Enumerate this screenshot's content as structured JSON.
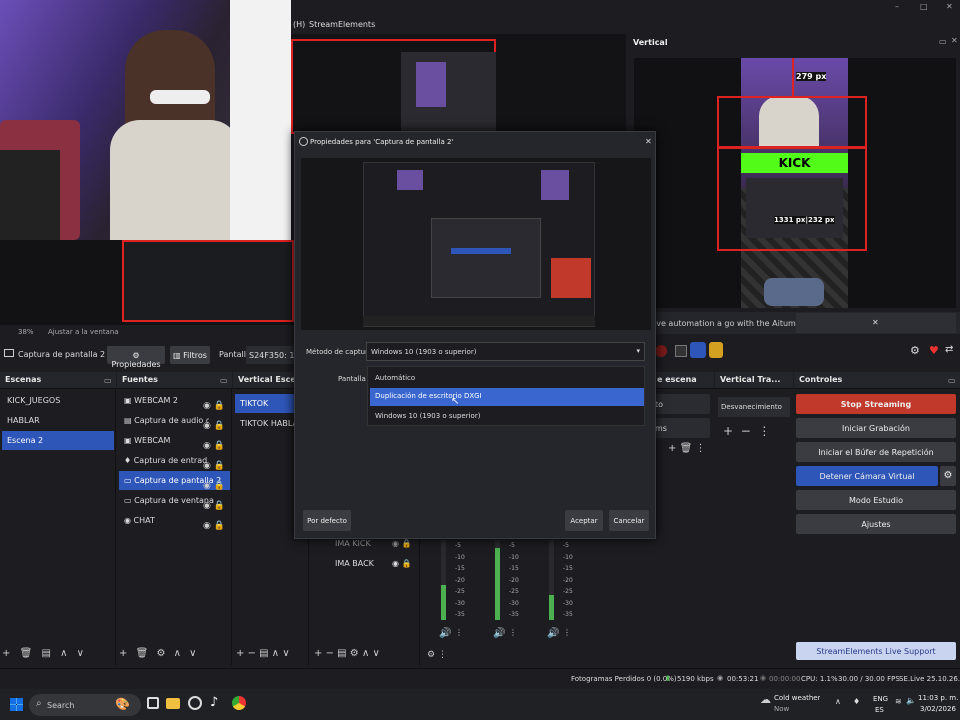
{
  "menubar": {
    "items": [
      "(H)",
      "StreamElements"
    ]
  },
  "window_controls": {
    "minimize": "–",
    "maximize": "□",
    "close": "✕"
  },
  "preview": {
    "zoom": "38%",
    "fit": "Ajustar a la ventana"
  },
  "vertical": {
    "title": "Vertical",
    "measure_top": "279 px",
    "measure_mid": "1331 px|232 px",
    "kick_text": "KICK"
  },
  "aitum": {
    "text": "ive automation a go with the Aitum App",
    "close": "✕"
  },
  "source_toolbar": {
    "source_name": "Captura de pantalla 2",
    "properties": "Propiedades",
    "filters": "Filtros",
    "pantalla_label": "Pantalla",
    "pantalla_value": "S24F350: 1920x"
  },
  "dialog": {
    "title": "Propiedades para 'Captura de pantalla 2'",
    "close": "✕",
    "method_label": "Método de captura",
    "method_value": "Windows 10 (1903 o superior)",
    "screen_label": "Pantalla",
    "options": [
      "Automático",
      "Duplicación de escritorio DXGI",
      "Windows 10 (1903 o superior)"
    ],
    "defaults_button": "Por defecto",
    "accept_button": "Aceptar",
    "cancel_button": "Cancelar"
  },
  "scenes": {
    "title": "Escenas",
    "items": [
      "KICK_JUEGOS",
      "HABLAR",
      "Escena 2"
    ],
    "selected": 2
  },
  "sources": {
    "title": "Fuentes",
    "items": [
      "WEBCAM 2",
      "Captura de audio de ap",
      "WEBCAM",
      "Captura de entrada au",
      "Captura de pantalla 2",
      "Captura de ventana",
      "CHAT"
    ],
    "selected": 4
  },
  "vertical_scenes": {
    "title": "Vertical Esce...",
    "items": [
      "TIKTOK",
      "TIKTOK HABLAR"
    ],
    "selected": 0
  },
  "vertical_sources": {
    "items": [
      "IMA KICK",
      "IMA BACK"
    ]
  },
  "scene_trans": {
    "title": "e escena",
    "dd1": "to",
    "dd2": "ms"
  },
  "vertical_trans": {
    "title": "Vertical Tra...",
    "dd": "Desvanecimiento"
  },
  "controls": {
    "title": "Controles",
    "buttons": [
      "Stop Streaming",
      "Iniciar Grabación",
      "Iniciar el Búfer de Repetición",
      "Detener Cámara Virtual",
      "Modo Estudio",
      "Ajustes"
    ],
    "se_support": "StreamElements Live Support"
  },
  "mixer": {
    "ticks": [
      "-5",
      "-10",
      "-15",
      "-20",
      "-25",
      "-30",
      "-35",
      "-40",
      "-45",
      "-50",
      "-55",
      "-60"
    ]
  },
  "statusbar": {
    "frames": "Fotogramas Perdidos 0 (0.0%)",
    "kbps": "5190 kbps",
    "time_live": "00:53:21",
    "time_rec": "00:00:00",
    "cpu": "CPU: 1.1%",
    "fps": "30.00 / 30.00 FPS",
    "se": "SE.Live 25.10.26.520"
  },
  "taskbar": {
    "search": "Search",
    "weather_title": "Cold weather",
    "weather_sub": "Now",
    "lang1": "ENG",
    "lang2": "ES",
    "time": "11:03 p. m.",
    "date": "3/02/2026"
  },
  "colors": {
    "accent": "#2e55b8",
    "stop": "#c0392b",
    "dialog_sel": "#3a66d0"
  }
}
